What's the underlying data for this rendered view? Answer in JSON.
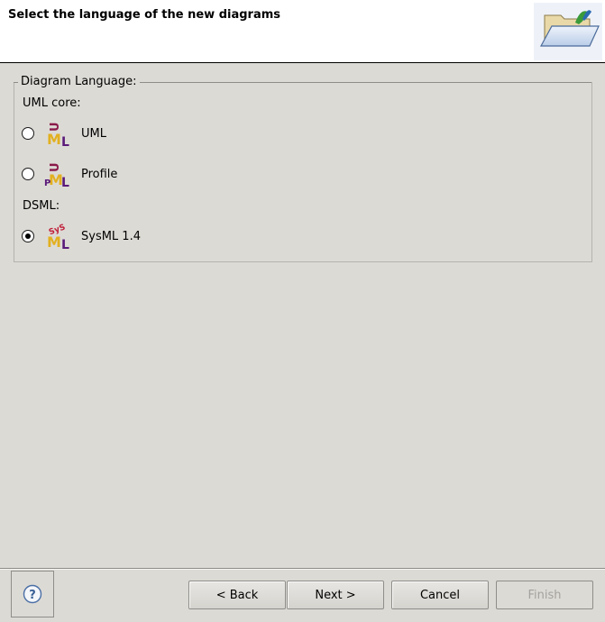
{
  "header": {
    "title": "Select the language of the new diagrams",
    "icon": "folder-open-icon"
  },
  "group": {
    "legend": "Diagram Language:",
    "sections": [
      {
        "label": "UML core:"
      },
      {
        "label": "DSML:"
      }
    ],
    "options": [
      {
        "label": "UML",
        "icon": "uml-icon",
        "checked": false
      },
      {
        "label": "Profile",
        "icon": "uml-profile-icon",
        "checked": false
      },
      {
        "label": "SysML 1.4",
        "icon": "sysml-icon",
        "checked": true
      }
    ]
  },
  "footer": {
    "help_icon": "help-icon",
    "back_label": "< Back",
    "next_label": "Next >",
    "cancel_label": "Cancel",
    "finish_label": "Finish"
  },
  "colors": {
    "background": "#dcdad5",
    "header_bg": "#ffffff",
    "icon_purple": "#5a1a7a",
    "icon_gold": "#e2b020"
  }
}
